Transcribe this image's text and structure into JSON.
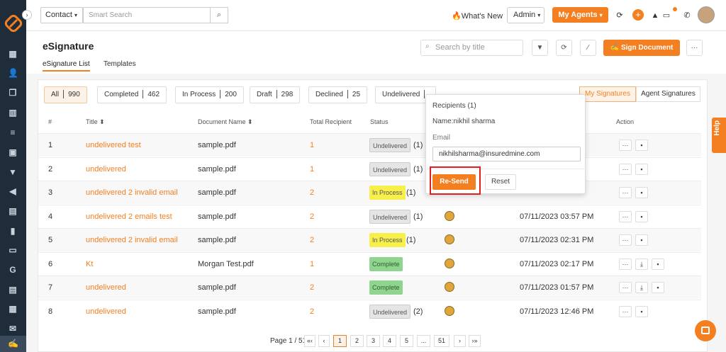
{
  "topbar": {
    "contact_select": "Contact",
    "search_placeholder": "Smart Search",
    "whats_new": "What's New",
    "admin_select": "Admin",
    "my_agents": "My Agents"
  },
  "page": {
    "title": "eSignature",
    "tabs": [
      "eSignature List",
      "Templates"
    ],
    "title_search_placeholder": "Search by title",
    "sign_document": "Sign Document"
  },
  "filters": [
    {
      "label": "All",
      "count": "990"
    },
    {
      "label": "Completed",
      "count": "462"
    },
    {
      "label": "In Process",
      "count": "200"
    },
    {
      "label": "Draft",
      "count": "298"
    },
    {
      "label": "Declined",
      "count": "25"
    },
    {
      "label": "Undelivered",
      "count": ""
    }
  ],
  "sig_toggle": [
    "My Signatures",
    "Agent Signatures"
  ],
  "table": {
    "headers": [
      "#",
      "Title ⬍",
      "Document Name ⬍",
      "Total Recipient",
      "Status",
      "Action"
    ],
    "rows": [
      {
        "num": "1",
        "title": "undelivered test",
        "doc": "sample.pdf",
        "recipients": "1",
        "status": "Undelivered",
        "status_type": "undelivered",
        "status_count": "(1)",
        "date": ""
      },
      {
        "num": "2",
        "title": "undelivered",
        "doc": "sample.pdf",
        "recipients": "1",
        "status": "Undelivered",
        "status_type": "undelivered",
        "status_count": "(1)",
        "date": ""
      },
      {
        "num": "3",
        "title": "undelivered 2 invalid email",
        "doc": "sample.pdf",
        "recipients": "2",
        "status": "In Process",
        "status_type": "inprocess",
        "status_count": "(1)",
        "date": ""
      },
      {
        "num": "4",
        "title": "undelivered 2 emails test",
        "doc": "sample.pdf",
        "recipients": "2",
        "status": "Undelivered",
        "status_type": "undelivered",
        "status_count": "(1)",
        "date": "07/11/2023 03:57 PM"
      },
      {
        "num": "5",
        "title": "undelivered 2 invalid email",
        "doc": "sample.pdf",
        "recipients": "2",
        "status": "In Process",
        "status_type": "inprocess",
        "status_count": "(1)",
        "date": "07/11/2023 02:31 PM"
      },
      {
        "num": "6",
        "title": "Kt",
        "doc": "Morgan Test.pdf",
        "recipients": "1",
        "status": "Complete",
        "status_type": "complete",
        "status_count": "",
        "date": "07/11/2023 02:17 PM"
      },
      {
        "num": "7",
        "title": "undelivered",
        "doc": "sample.pdf",
        "recipients": "2",
        "status": "Complete",
        "status_type": "complete",
        "status_count": "",
        "date": "07/11/2023 01:57 PM"
      },
      {
        "num": "8",
        "title": "undelivered",
        "doc": "sample.pdf",
        "recipients": "2",
        "status": "Undelivered",
        "status_type": "undelivered",
        "status_count": "(2)",
        "date": "07/11/2023 12:46 PM"
      }
    ]
  },
  "popup": {
    "heading": "Recipients (1)",
    "name_line": "Name:nikhil sharma",
    "email_label": "Email",
    "email_value": "nikhilsharma@insuredmine.com",
    "resend": "Re-Send",
    "reset": "Reset"
  },
  "pagination": {
    "label": "Page 1 / 51",
    "buttons": [
      "«‹",
      "‹",
      "1",
      "2",
      "3",
      "4",
      "5",
      "...",
      "51",
      "›",
      "›»"
    ]
  },
  "help": "Help",
  "colors": {
    "accent": "#f47f20",
    "sidebar": "#1f2d3a"
  }
}
